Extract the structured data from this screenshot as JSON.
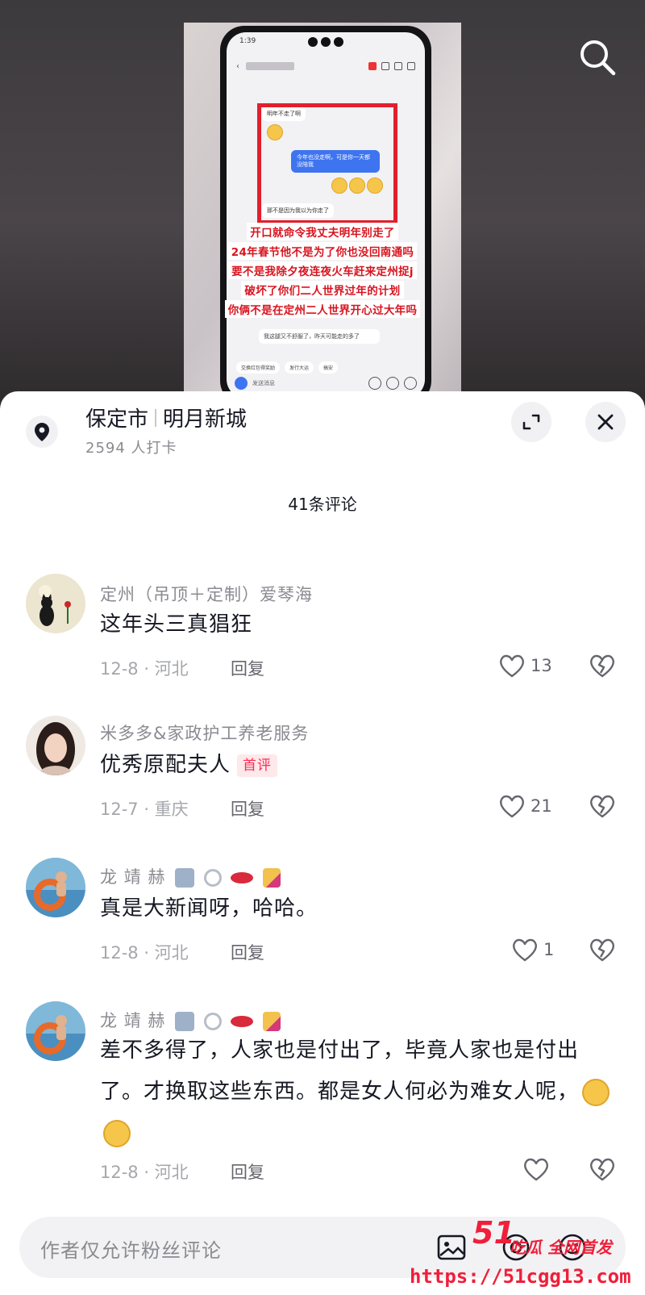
{
  "video": {
    "status_time": "1:39",
    "chat": {
      "bubble1": "明年不走了啊",
      "bubble2": "今年也没走啊，可是你一天都没陪我",
      "bubble3": "那不是因为我以为你走了",
      "bubble4": "我这腿又不舒服了，昨天可能走的多了"
    },
    "caption_lines": [
      "开口就命令我丈夫明年别走了",
      "24年春节他不是为了你也没回南通吗",
      "要不是我除夕夜连夜火车赶来定州捉j",
      "破坏了你们二人世界过年的计划",
      "你俩不是在定州二人世界开心过大年吗"
    ],
    "chips": [
      "交换红包得奖励",
      "发行大运",
      "搞安"
    ],
    "input_placeholder": "发送消息"
  },
  "location": {
    "city": "保定市",
    "place": "明月新城",
    "checkins": "2594 人打卡"
  },
  "comment_count": "41条评论",
  "comments": [
    {
      "name": "定州（吊顶＋定制）爱琴海",
      "text": "这年头三真猖狂",
      "tag": "",
      "meta": "12-8 · 河北",
      "reply": "回复",
      "likes": "13"
    },
    {
      "name": "米多多&家政护工养老服务",
      "text": "优秀原配夫人",
      "tag": "首评",
      "meta": "12-7 · 重庆",
      "reply": "回复",
      "likes": "21"
    },
    {
      "name": "龙 靖 赫",
      "text": "真是大新闻呀，哈哈。",
      "tag": "",
      "meta": "12-8 · 河北",
      "reply": "回复",
      "likes": "1"
    },
    {
      "name": "龙 靖 赫",
      "text": "差不多得了，人家也是付出了，毕竟人家也是付出了。才换取这些东西。都是女人何必为难女人呢，",
      "tag": "",
      "meta": "12-8 · 河北",
      "reply": "回复",
      "likes": ""
    }
  ],
  "bottom_input": {
    "placeholder": "作者仅允许粉丝评论"
  },
  "watermark": {
    "logo": "51",
    "slogan": "吃瓜 全网首发",
    "url": "https://51cgg13.com"
  },
  "colors": {
    "accent": "#fe2c55",
    "caption_red": "#d8141f",
    "watermark_red": "#ef1f3a"
  }
}
